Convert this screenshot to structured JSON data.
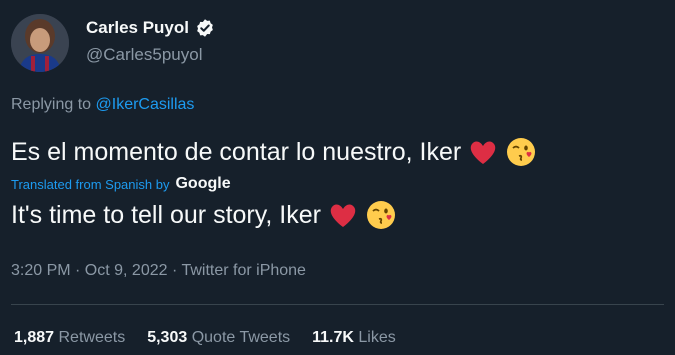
{
  "author": {
    "name": "Carles Puyol",
    "handle": "@Carles5puyol"
  },
  "reply": {
    "prefix": "Replying to",
    "target": "@IkerCasillas"
  },
  "tweet": {
    "original": "Es el momento de contar lo nuestro, Iker",
    "translation_note": "Translated from Spanish by",
    "translator": "Google",
    "translated": "It's time to tell our story, Iker"
  },
  "meta": "3:20 PM · Oct 9, 2022 · Twitter for iPhone",
  "stats": {
    "retweets_count": "1,887",
    "retweets_label": "Retweets",
    "quotes_count": "5,303",
    "quotes_label": "Quote Tweets",
    "likes_count": "11.7K",
    "likes_label": "Likes"
  },
  "colors": {
    "background": "#16202b",
    "link": "#1d9bf0",
    "muted": "#8b98a5",
    "text": "#f7f9f9"
  },
  "icons": [
    "avatar",
    "verified-badge-icon",
    "red-heart-emoji",
    "kissing-face-emoji"
  ]
}
